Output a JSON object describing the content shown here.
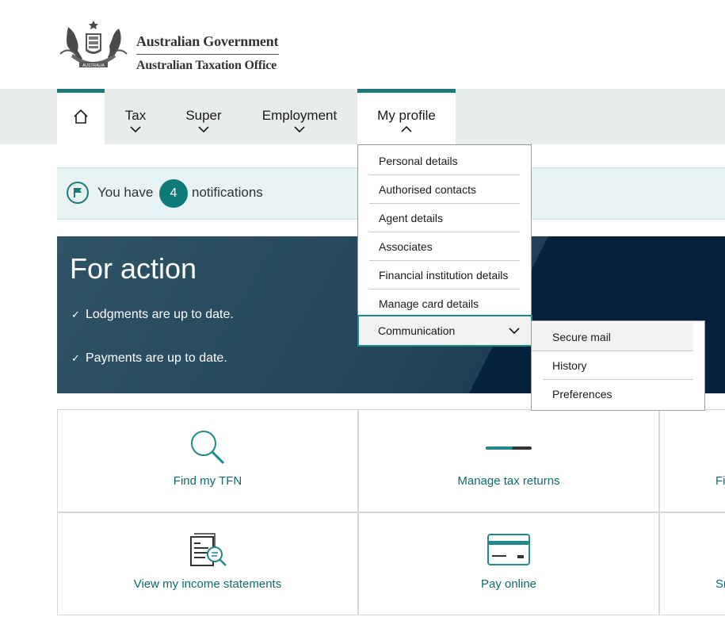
{
  "header": {
    "crest_text": "AUSTRALIA",
    "line1": "Australian Government",
    "line2": "Australian Taxation Office"
  },
  "nav": {
    "home_icon": "home-icon",
    "items": [
      {
        "label": "Tax"
      },
      {
        "label": "Super"
      },
      {
        "label": "Employment"
      },
      {
        "label": "My profile"
      }
    ]
  },
  "profile_menu": {
    "items": [
      "Personal details",
      "Authorised contacts",
      "Agent details",
      "Associates",
      "Financial institution details",
      "Manage card details"
    ],
    "expanded": "Communication",
    "submenu": [
      "Secure mail",
      "History",
      "Preferences"
    ]
  },
  "notifications": {
    "prefix": "You have",
    "count": "4",
    "suffix": "notifications"
  },
  "for_action": {
    "title": "For action",
    "items": [
      "Lodgments are up to date.",
      "Payments are up to date."
    ]
  },
  "tiles": [
    {
      "label": "Find my TFN",
      "icon": "magnifier-icon"
    },
    {
      "label": "Manage tax returns",
      "icon": "progress-bar-icon"
    },
    {
      "label": "Fi",
      "icon": ""
    },
    {
      "label": "View my income statements",
      "icon": "income-statement-icon"
    },
    {
      "label": "Pay online",
      "icon": "credit-card-icon"
    },
    {
      "label": "Sma",
      "icon": ""
    }
  ],
  "colors": {
    "accent": "#1e7a7a",
    "banner_dark": "#04223d",
    "nav_bg": "#e9ecec",
    "notif_bg": "#e7f3f3"
  }
}
